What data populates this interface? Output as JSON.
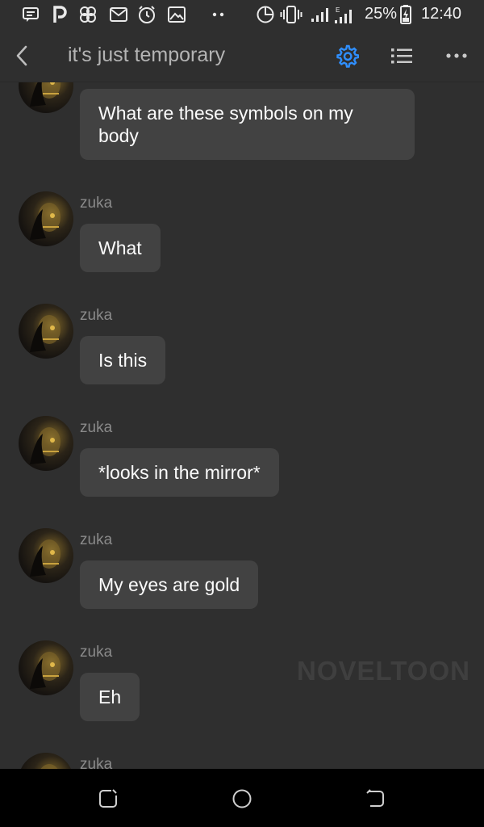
{
  "status_bar": {
    "battery": "25%",
    "time": "12:40",
    "network_label": "E"
  },
  "header": {
    "title": "it's just temporary",
    "accent_color": "#2f8fff"
  },
  "messages": [
    {
      "sender": "",
      "text": "What are these symbols on my body"
    },
    {
      "sender": "zuka",
      "text": "What"
    },
    {
      "sender": "zuka",
      "text": "Is this"
    },
    {
      "sender": "zuka",
      "text": "*looks in the mirror*"
    },
    {
      "sender": "zuka",
      "text": "My eyes are gold"
    },
    {
      "sender": "zuka",
      "text": "Eh"
    },
    {
      "sender": "zuka",
      "text": ""
    }
  ],
  "watermark": "NOVELTOON",
  "icons": {
    "status": [
      "message-icon",
      "p-icon",
      "pinwheel-icon",
      "mail-icon",
      "alarm-icon",
      "image-icon",
      "more-dots-icon",
      "data-saver-icon",
      "vibrate-icon",
      "signal-icon",
      "signal-e-icon",
      "battery-charging-icon"
    ],
    "header": [
      "back-icon",
      "gear-icon",
      "list-icon",
      "more-icon"
    ],
    "nav": [
      "recent-apps-icon",
      "home-icon",
      "back-nav-icon"
    ]
  }
}
